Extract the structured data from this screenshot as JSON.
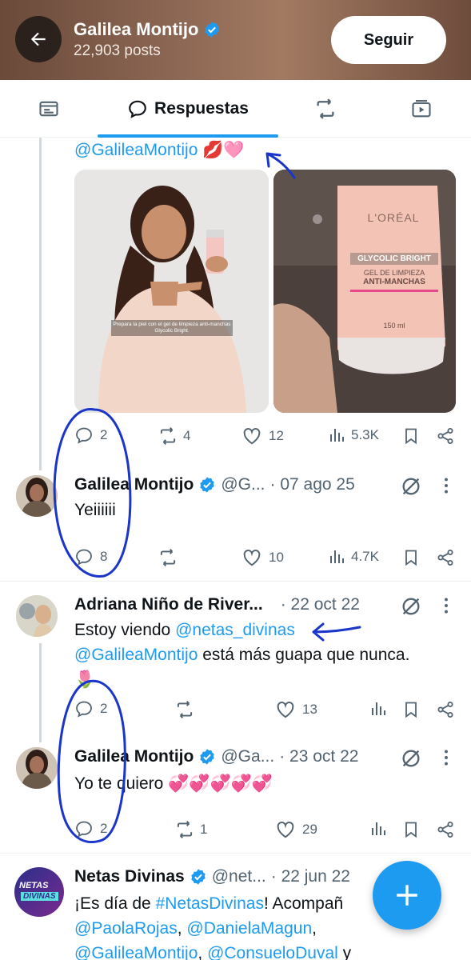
{
  "header": {
    "name": "Galilea Montijo",
    "posts": "22,903 posts",
    "follow_label": "Seguir"
  },
  "tabs": {
    "active_label": "Respuestas"
  },
  "post1": {
    "mention_line": "@GalileaMontijo",
    "emoji": "💋🩷",
    "image1_caption": "Prepara la piel con el gel de limpieza anti-manchas Glycolic Bright.",
    "image2_brand": "L'ORÉAL",
    "image2_product": "GLYCOLIC BRIGHT",
    "image2_line1": "GEL DE LIMPIEZA",
    "image2_line2": "ANTI-MANCHAS",
    "image2_size": "150 ml",
    "replies": "2",
    "retweets": "4",
    "likes": "12",
    "views": "5.3K"
  },
  "post2": {
    "name": "Galilea Montijo",
    "handle": "@G...",
    "date": "· 07 ago 25",
    "text": "Yeiiiiii",
    "replies": "8",
    "retweets": "",
    "likes": "10",
    "views": "4.7K"
  },
  "post3": {
    "name": "Adriana Niño de River...",
    "date": "· 22 oct 22",
    "text_pre": "Estoy viendo ",
    "mention1": "@netas_divinas",
    "mention2": "@GalileaMontijo",
    "text_post": " está más guapa que nunca.",
    "emoji": "🌷",
    "replies": "2",
    "retweets": "",
    "likes": "13"
  },
  "post4": {
    "name": "Galilea Montijo",
    "handle": "@Ga...",
    "date": "· 23 oct 22",
    "text": "Yo te quiero ",
    "emoji": "💞💞💞💞💞",
    "replies": "2",
    "retweets": "1",
    "likes": "29"
  },
  "post5": {
    "name": "Netas Divinas",
    "handle": "@net...",
    "date": "· 22 jun 22",
    "avatar_text1": "NETAS",
    "avatar_text2": "DIVINAS",
    "line1_pre": "¡Es día de ",
    "line1_tag": "#NetasDivinas",
    "line1_post": "! Acompañ",
    "line2_a": "@PaolaRojas",
    "line2_b": "@DanielaMagun",
    "line3_a": "@GalileaMontijo",
    "line3_b": "@ConsueloDuval",
    "line3_post": " y",
    "sep": ", "
  },
  "colors": {
    "accent": "#1d9bf0",
    "verified": "#1d9bf0",
    "muted": "#536471",
    "annotation_ink": "#1a35c9"
  },
  "icons": [
    "back-arrow-icon",
    "verified-icon",
    "reply-icon",
    "retweet-icon",
    "like-icon",
    "views-icon",
    "bookmark-icon",
    "share-icon",
    "grok-icon",
    "more-icon",
    "plus-icon"
  ]
}
